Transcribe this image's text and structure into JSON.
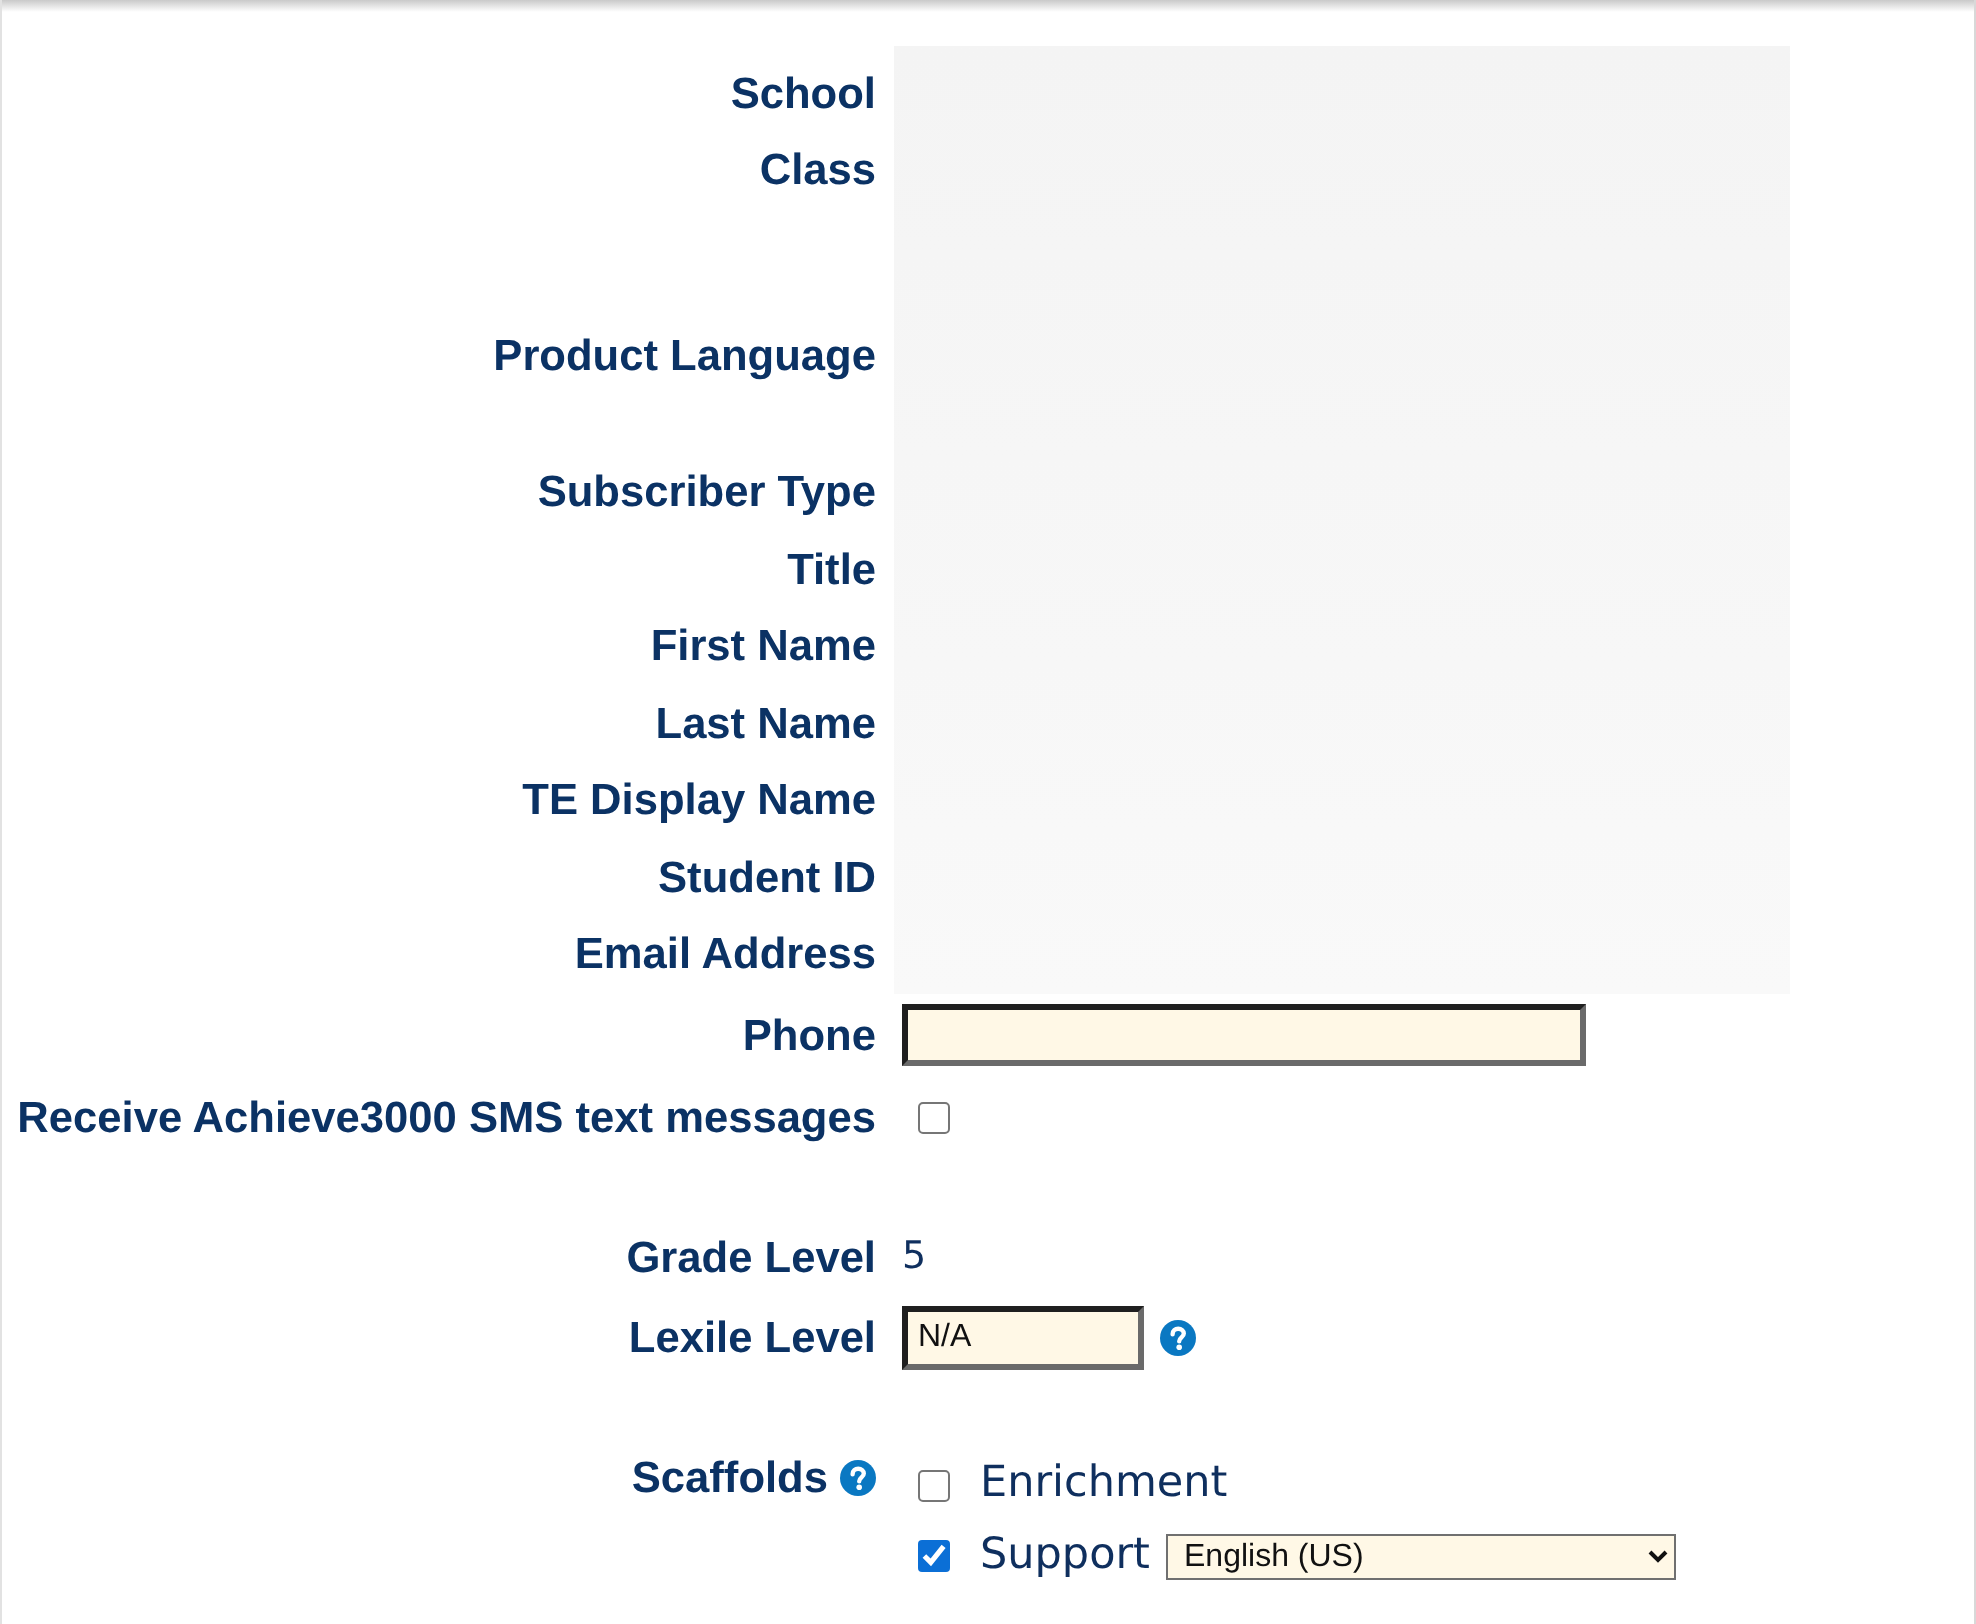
{
  "fields": [
    {
      "kind": "text",
      "label": "School"
    },
    {
      "kind": "text",
      "label": "Class"
    },
    {
      "kind": "text",
      "label": "Product Language"
    },
    {
      "kind": "text",
      "label": "Subscriber Type"
    },
    {
      "kind": "text",
      "label": "Title"
    },
    {
      "kind": "text",
      "label": "First Name"
    },
    {
      "kind": "text",
      "label": "Last Name"
    },
    {
      "kind": "text",
      "label": "TE Display Name"
    },
    {
      "kind": "text",
      "label": "Student ID"
    },
    {
      "kind": "text",
      "label": "Email Address"
    },
    {
      "kind": "input",
      "label": "Phone"
    },
    {
      "kind": "checkbox",
      "label": "Receive Achieve3000 SMS text messages",
      "checked": false
    },
    {
      "kind": "text",
      "label": "Grade Level",
      "value": "5"
    },
    {
      "kind": "input",
      "label": "Lexile Level",
      "value": "N/A",
      "help": true
    },
    {
      "kind": "options",
      "label": "Scaffolds",
      "help": true,
      "options": [
        {
          "label": "Enrichment",
          "checked": false
        },
        {
          "label": "Support",
          "checked": true,
          "select": "English (US)"
        }
      ]
    }
  ]
}
